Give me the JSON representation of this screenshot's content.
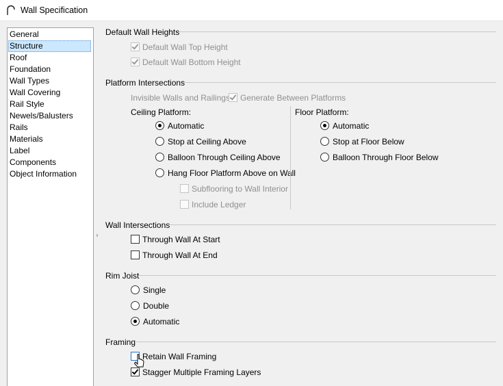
{
  "window": {
    "title": "Wall Specification"
  },
  "nav": {
    "items": [
      {
        "label": "General"
      },
      {
        "label": "Structure"
      },
      {
        "label": "Roof"
      },
      {
        "label": "Foundation"
      },
      {
        "label": "Wall Types"
      },
      {
        "label": "Wall Covering"
      },
      {
        "label": "Rail Style"
      },
      {
        "label": "Newels/Balusters"
      },
      {
        "label": "Rails"
      },
      {
        "label": "Materials"
      },
      {
        "label": "Label"
      },
      {
        "label": "Components"
      },
      {
        "label": "Object Information"
      }
    ],
    "selected": "Structure"
  },
  "default_wall_heights": {
    "title": "Default Wall Heights",
    "top": {
      "label": "Default Wall Top Height",
      "checked": true,
      "enabled": false
    },
    "bottom": {
      "label": "Default Wall Bottom Height",
      "checked": true,
      "enabled": false
    }
  },
  "platform_intersections": {
    "title": "Platform Intersections",
    "invisible_label": "Invisible Walls and Railings:",
    "generate_between": {
      "label": "Generate Between Platforms",
      "checked": true,
      "enabled": false
    },
    "ceiling": {
      "title": "Ceiling Platform:",
      "options": [
        {
          "label": "Automatic",
          "selected": true
        },
        {
          "label": "Stop at Ceiling Above",
          "selected": false
        },
        {
          "label": "Balloon Through Ceiling Above",
          "selected": false
        },
        {
          "label": "Hang Floor Platform Above on Wall",
          "selected": false
        }
      ],
      "subflooring": {
        "label": "Subflooring to Wall Interior",
        "checked": false,
        "enabled": false
      },
      "ledger": {
        "label": "Include Ledger",
        "checked": false,
        "enabled": false
      }
    },
    "floor": {
      "title": "Floor Platform:",
      "options": [
        {
          "label": "Automatic",
          "selected": true
        },
        {
          "label": "Stop at Floor Below",
          "selected": false
        },
        {
          "label": "Balloon Through Floor Below",
          "selected": false
        }
      ]
    }
  },
  "wall_intersections": {
    "title": "Wall Intersections",
    "start": {
      "label": "Through Wall At Start",
      "checked": false
    },
    "end": {
      "label": "Through Wall At End",
      "checked": false
    }
  },
  "rim_joist": {
    "title": "Rim Joist",
    "options": [
      {
        "label": "Single",
        "selected": false
      },
      {
        "label": "Double",
        "selected": false
      },
      {
        "label": "Automatic",
        "selected": true
      }
    ]
  },
  "framing": {
    "title": "Framing",
    "retain": {
      "label": "Retain Wall Framing",
      "checked": false
    },
    "stagger": {
      "label": "Stagger Multiple Framing Layers",
      "checked": true
    }
  }
}
